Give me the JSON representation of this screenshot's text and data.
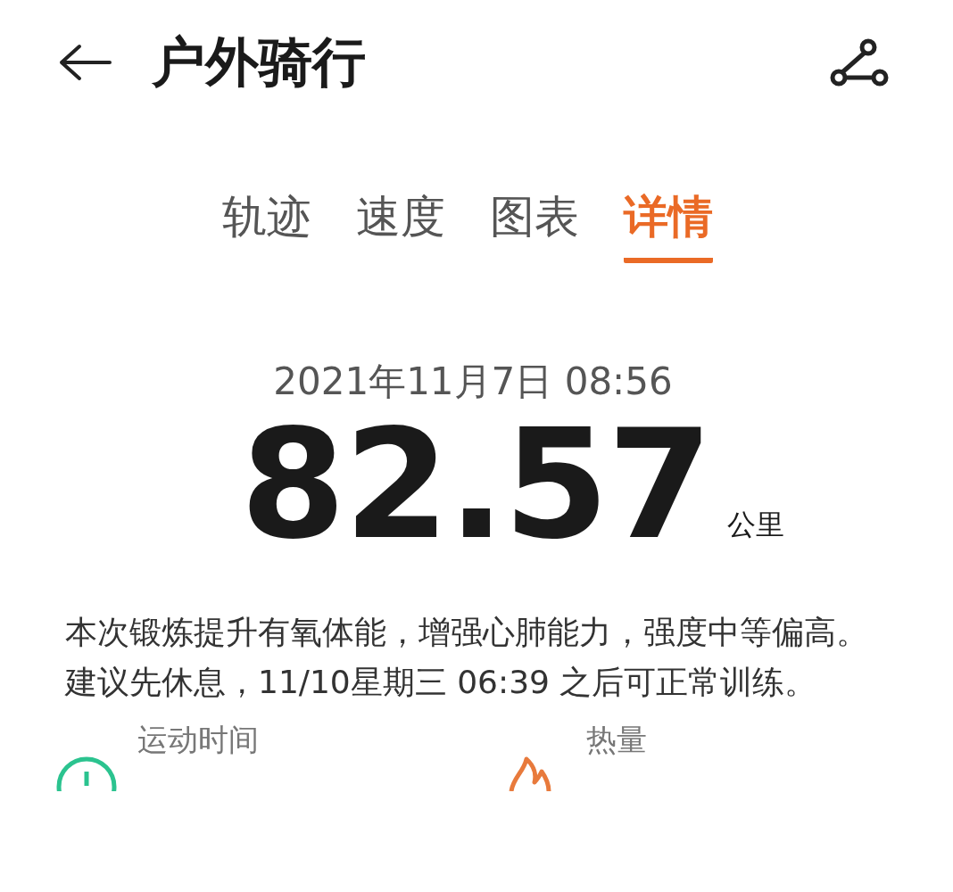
{
  "header": {
    "title": "户外骑行"
  },
  "tabs": [
    {
      "label": "轨迹",
      "selected": false
    },
    {
      "label": "速度",
      "selected": false
    },
    {
      "label": "图表",
      "selected": false
    },
    {
      "label": "详情",
      "selected": true
    }
  ],
  "summary": {
    "datetime": "2021年11月7日 08:56",
    "distance": "82.57",
    "unit": "公里",
    "advice": "本次锻炼提升有氧体能，增强心肺能力，强度中等偏高。建议先休息，11/10星期三 06:39 之后可正常训练。"
  },
  "stats": [
    {
      "kind": "time",
      "label": "运动时间"
    },
    {
      "kind": "calories",
      "label": "热量"
    }
  ]
}
